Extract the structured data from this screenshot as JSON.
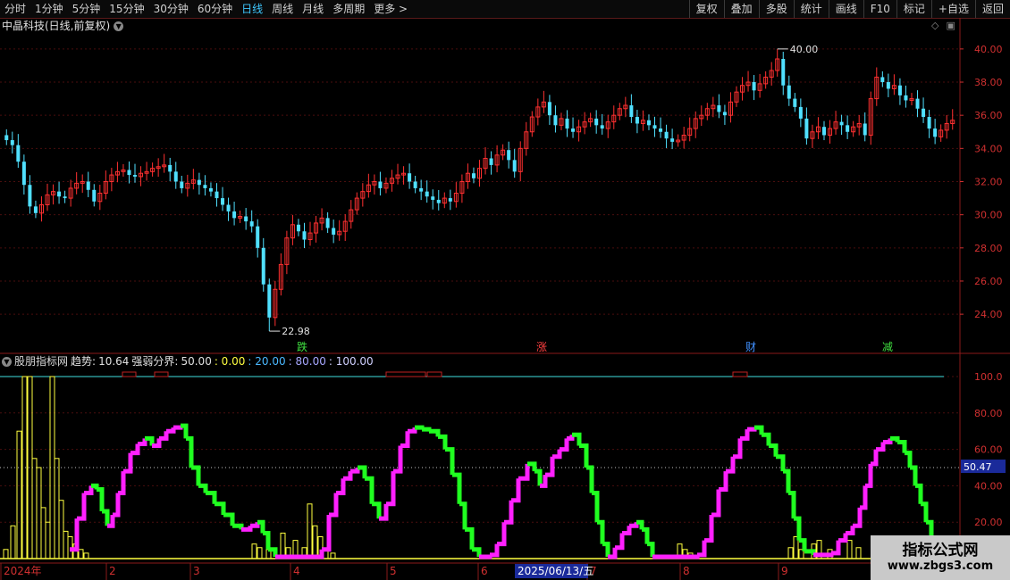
{
  "toolbar": {
    "periods": [
      "分时",
      "1分钟",
      "5分钟",
      "15分钟",
      "30分钟",
      "60分钟",
      "日线",
      "周线",
      "月线",
      "多周期",
      "更多 >"
    ],
    "active_index": 6,
    "actions": [
      "复权",
      "叠加",
      "多股",
      "统计",
      "画线",
      "F10",
      "标记",
      "+自选",
      "返回"
    ]
  },
  "stock": {
    "title": "中晶科技(日线,前复权)"
  },
  "indicator": {
    "name": "股朋指标网",
    "trend_label": "趋势:",
    "trend_value": "10.64",
    "boundary_label": "强弱分界:",
    "boundary_value": "50.00",
    "levels": [
      ": 0.00",
      ": 20.00",
      ": 80.00",
      ": 100.00"
    ]
  },
  "price_axis": {
    "ticks": [
      "40.00",
      "38.00",
      "36.00",
      "34.00",
      "32.00",
      "30.00",
      "28.00",
      "26.00",
      "24.00"
    ]
  },
  "indicator_axis": {
    "ticks": [
      "100.0",
      "80.00",
      "60.00",
      "40.00",
      "20.00"
    ],
    "current": "50.47"
  },
  "annotations": {
    "high": "40.00",
    "low": "22.98"
  },
  "signals": [
    "跌",
    "涨",
    "财",
    "减"
  ],
  "time_axis": {
    "labels": [
      "2024年",
      "2",
      "3",
      "4",
      "5",
      "6",
      "7",
      "8",
      "9"
    ],
    "cursor": "2025/06/13/五"
  },
  "watermark": {
    "title": "指标公式网",
    "url": "www.zbgs3.com"
  },
  "colors": {
    "up": "#ff3030",
    "down": "#50e0ff",
    "magenta": "#ff20ff",
    "green": "#20ff20",
    "yellow": "#ffff40",
    "cyan": "#40e0e0"
  },
  "chart_data": {
    "type": "candlestick",
    "price_range": [
      22.5,
      40.8
    ],
    "candles_close": [
      34.5,
      34.2,
      33.2,
      31.8,
      30.5,
      30.1,
      30.6,
      31.2,
      31.4,
      31.1,
      31.0,
      31.6,
      31.9,
      32.0,
      31.5,
      30.8,
      31.3,
      32.0,
      32.4,
      32.6,
      32.7,
      32.4,
      32.3,
      32.5,
      32.6,
      32.8,
      32.9,
      33.0,
      32.6,
      32.0,
      31.6,
      31.9,
      32.1,
      31.8,
      31.6,
      31.4,
      31.0,
      30.6,
      30.2,
      29.8,
      29.9,
      29.6,
      29.3,
      28.0,
      25.8,
      23.8,
      25.5,
      27.0,
      28.6,
      29.4,
      29.0,
      28.5,
      28.9,
      29.5,
      29.8,
      29.2,
      28.8,
      29.0,
      29.6,
      30.3,
      31.0,
      31.4,
      31.8,
      32.0,
      31.6,
      31.9,
      32.2,
      32.4,
      32.5,
      32.0,
      31.6,
      31.4,
      31.1,
      30.9,
      30.7,
      31.0,
      30.8,
      31.3,
      32.0,
      32.5,
      32.2,
      32.8,
      33.4,
      33.0,
      33.6,
      33.9,
      33.3,
      32.6,
      34.0,
      35.0,
      35.9,
      36.5,
      36.8,
      36.0,
      35.4,
      35.8,
      35.2,
      35.0,
      35.3,
      35.6,
      35.8,
      35.4,
      35.2,
      35.6,
      36.0,
      36.4,
      36.6,
      35.9,
      35.5,
      35.7,
      35.4,
      35.2,
      35.0,
      34.6,
      34.4,
      34.5,
      34.8,
      35.2,
      35.8,
      36.0,
      36.4,
      36.6,
      36.2,
      36.0,
      36.8,
      37.4,
      37.8,
      38.0,
      37.5,
      37.9,
      38.3,
      38.7,
      39.4,
      37.8,
      37.0,
      36.5,
      35.8,
      34.6,
      35.0,
      35.3,
      34.8,
      35.2,
      35.6,
      35.4,
      35.0,
      35.3,
      35.5,
      34.8,
      37.0,
      38.3,
      38.0,
      37.6,
      37.8,
      37.2,
      36.9,
      37.0,
      36.4,
      35.9,
      35.2,
      34.7,
      35.1,
      35.5,
      35.7
    ]
  }
}
